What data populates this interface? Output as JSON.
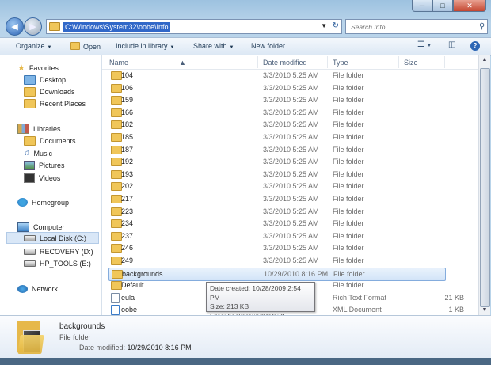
{
  "address": {
    "path": "C:\\Windows\\System32\\oobe\\Info"
  },
  "search": {
    "placeholder": "Search Info"
  },
  "toolbar": {
    "organize": "Organize",
    "open": "Open",
    "include": "Include in library",
    "share": "Share with",
    "new_folder": "New folder"
  },
  "nav": {
    "favorites": "Favorites",
    "desktop": "Desktop",
    "downloads": "Downloads",
    "recent": "Recent Places",
    "libraries": "Libraries",
    "documents": "Documents",
    "music": "Music",
    "pictures": "Pictures",
    "videos": "Videos",
    "homegroup": "Homegroup",
    "computer": "Computer",
    "local_disk": "Local Disk (C:)",
    "recovery": "RECOVERY (D:)",
    "hp_tools": "HP_TOOLS (E:)",
    "network": "Network"
  },
  "columns": {
    "name": "Name",
    "date": "Date modified",
    "type": "Type",
    "size": "Size"
  },
  "files": [
    {
      "name": "104",
      "date": "3/3/2010 5:25 AM",
      "type": "File folder",
      "size": "",
      "kind": "folder"
    },
    {
      "name": "106",
      "date": "3/3/2010 5:25 AM",
      "type": "File folder",
      "size": "",
      "kind": "folder"
    },
    {
      "name": "159",
      "date": "3/3/2010 5:25 AM",
      "type": "File folder",
      "size": "",
      "kind": "folder"
    },
    {
      "name": "166",
      "date": "3/3/2010 5:25 AM",
      "type": "File folder",
      "size": "",
      "kind": "folder"
    },
    {
      "name": "182",
      "date": "3/3/2010 5:25 AM",
      "type": "File folder",
      "size": "",
      "kind": "folder"
    },
    {
      "name": "185",
      "date": "3/3/2010 5:25 AM",
      "type": "File folder",
      "size": "",
      "kind": "folder"
    },
    {
      "name": "187",
      "date": "3/3/2010 5:25 AM",
      "type": "File folder",
      "size": "",
      "kind": "folder"
    },
    {
      "name": "192",
      "date": "3/3/2010 5:25 AM",
      "type": "File folder",
      "size": "",
      "kind": "folder"
    },
    {
      "name": "193",
      "date": "3/3/2010 5:25 AM",
      "type": "File folder",
      "size": "",
      "kind": "folder"
    },
    {
      "name": "202",
      "date": "3/3/2010 5:25 AM",
      "type": "File folder",
      "size": "",
      "kind": "folder"
    },
    {
      "name": "217",
      "date": "3/3/2010 5:25 AM",
      "type": "File folder",
      "size": "",
      "kind": "folder"
    },
    {
      "name": "223",
      "date": "3/3/2010 5:25 AM",
      "type": "File folder",
      "size": "",
      "kind": "folder"
    },
    {
      "name": "234",
      "date": "3/3/2010 5:25 AM",
      "type": "File folder",
      "size": "",
      "kind": "folder"
    },
    {
      "name": "237",
      "date": "3/3/2010 5:25 AM",
      "type": "File folder",
      "size": "",
      "kind": "folder"
    },
    {
      "name": "246",
      "date": "3/3/2010 5:25 AM",
      "type": "File folder",
      "size": "",
      "kind": "folder"
    },
    {
      "name": "249",
      "date": "3/3/2010 5:25 AM",
      "type": "File folder",
      "size": "",
      "kind": "folder"
    },
    {
      "name": "backgrounds",
      "date": "10/29/2010 8:16 PM",
      "type": "File folder",
      "size": "",
      "kind": "folder",
      "selected": true
    },
    {
      "name": "Default",
      "date": "",
      "type": "File folder",
      "size": "",
      "kind": "folder"
    },
    {
      "name": "eula",
      "date": "",
      "type": "Rich Text Format",
      "size": "21 KB",
      "kind": "rtf"
    },
    {
      "name": "oobe",
      "date": "",
      "type": "XML Document",
      "size": "1 KB",
      "kind": "xml"
    }
  ],
  "tooltip": {
    "created": "Date created: 10/28/2009 2:54 PM",
    "size": "Size: 213 KB",
    "files": "Files: backgroundDefault"
  },
  "details": {
    "name": "backgrounds",
    "type": "File folder",
    "date_label": "Date modified:",
    "date_value": "10/29/2010 8:16 PM"
  }
}
